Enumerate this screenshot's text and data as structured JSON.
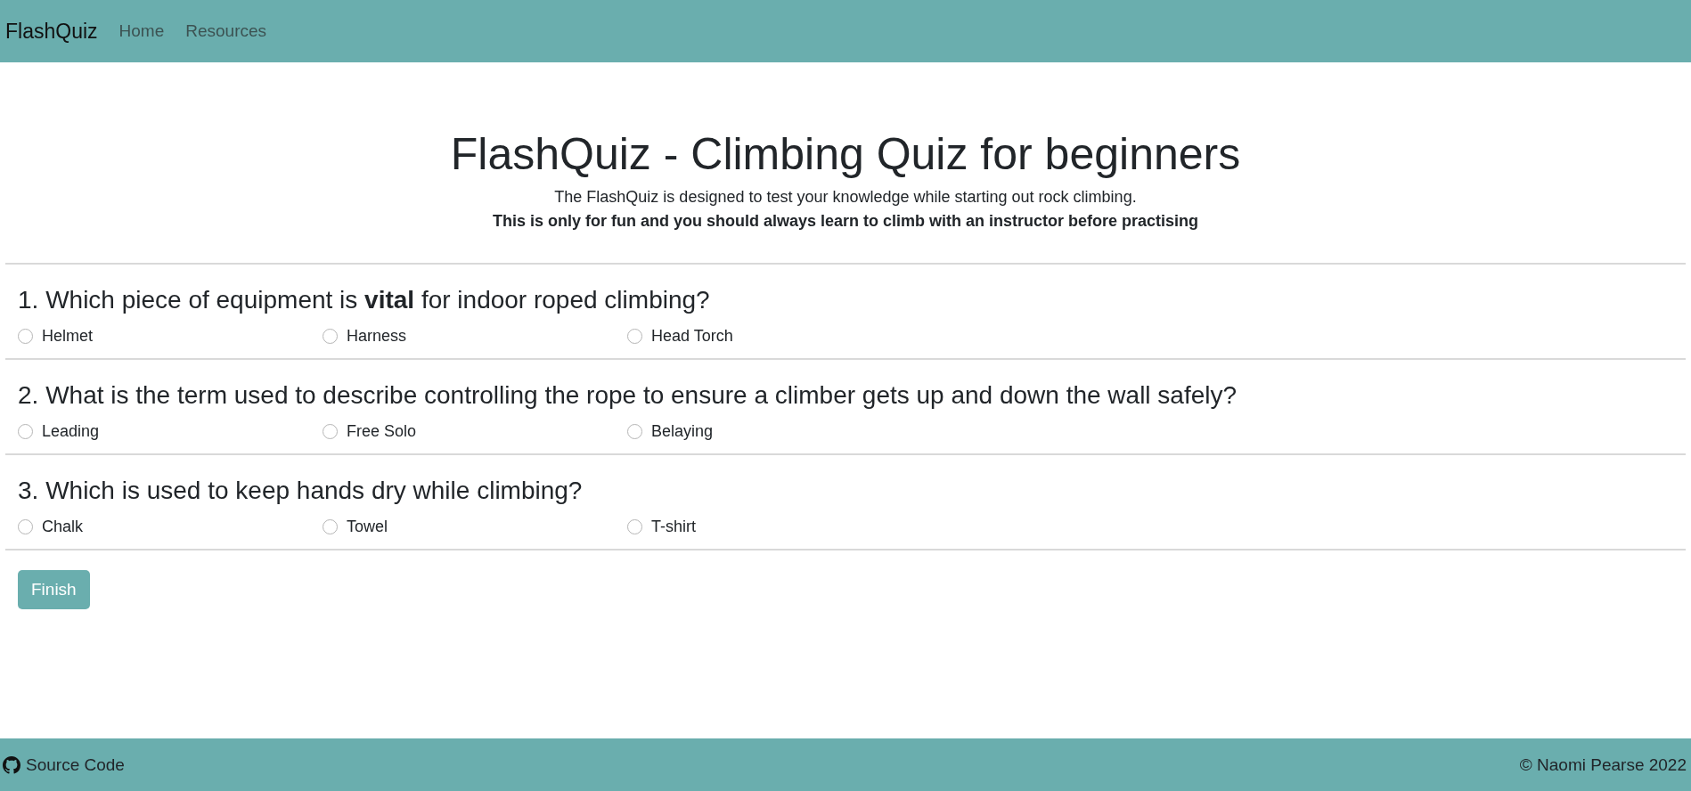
{
  "navbar": {
    "brand": "FlashQuiz",
    "links": [
      {
        "label": "Home"
      },
      {
        "label": "Resources"
      }
    ]
  },
  "header": {
    "title": "FlashQuiz - Climbing Quiz for beginners",
    "subtitle": "The FlashQuiz is designed to test your knowledge while starting out rock climbing.",
    "notice": "This is only for fun and you should always learn to climb with an instructor before practising"
  },
  "questions": [
    {
      "text": "1. Which piece of equipment is **vital** for indoor roped climbing?",
      "options": [
        {
          "label": "Helmet",
          "selected": false
        },
        {
          "label": "Harness",
          "selected": false
        },
        {
          "label": "Head Torch",
          "selected": false
        }
      ]
    },
    {
      "text": "2. What is the term used to describe controlling the rope to ensure a climber gets up and down the wall safely?",
      "options": [
        {
          "label": "Leading",
          "selected": false
        },
        {
          "label": "Free Solo",
          "selected": false
        },
        {
          "label": "Belaying",
          "selected": false
        }
      ]
    },
    {
      "text": "3. Which is used to keep hands dry while climbing?",
      "options": [
        {
          "label": "Chalk",
          "selected": false
        },
        {
          "label": "Towel",
          "selected": false
        },
        {
          "label": "T-shirt",
          "selected": false
        }
      ]
    }
  ],
  "finish_button": "Finish",
  "footer": {
    "source_link": "Source Code",
    "copyright": "© Naomi Pearse 2022"
  }
}
